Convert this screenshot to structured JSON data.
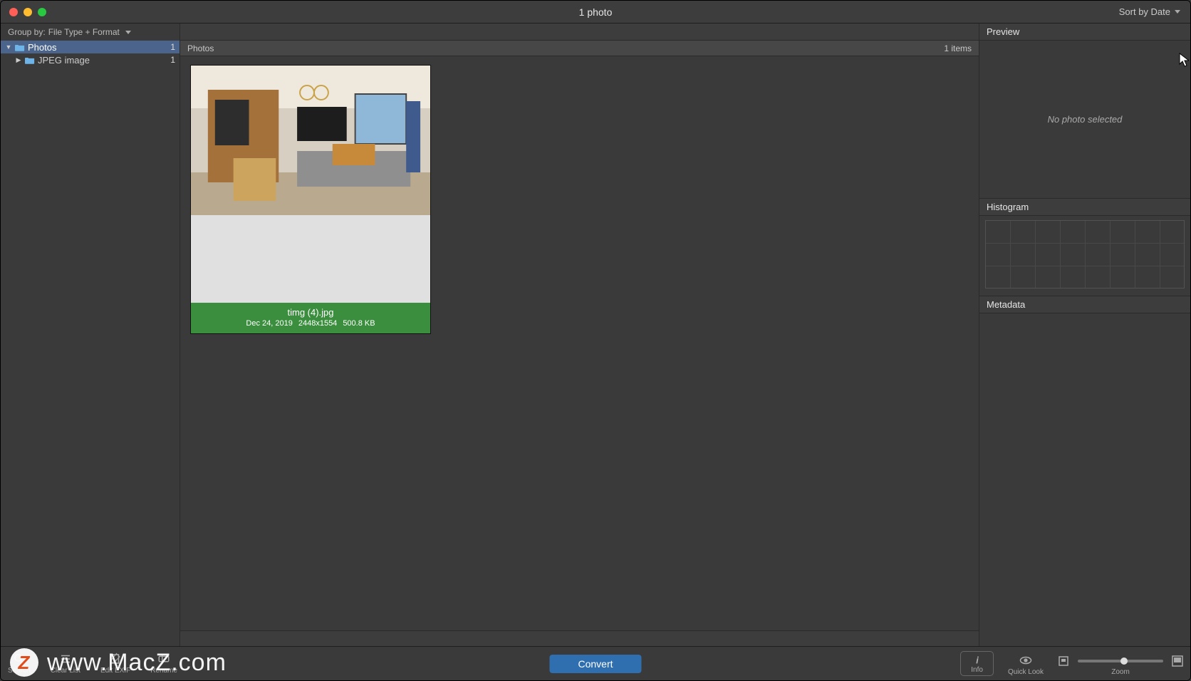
{
  "titlebar": {
    "title": "1 photo",
    "sort_label": "Sort by Date"
  },
  "sidebar": {
    "groupby_label": "Group by:",
    "groupby_value": "File Type + Format",
    "tree": [
      {
        "label": "Photos",
        "count": "1",
        "selected": true,
        "level": 0,
        "expanded": true
      },
      {
        "label": "JPEG image",
        "count": "1",
        "selected": false,
        "level": 1,
        "expanded": false
      }
    ]
  },
  "center": {
    "section_label": "Photos",
    "item_count_label": "1 items",
    "thumbs": [
      {
        "filename": "timg (4).jpg",
        "date": "Dec 24, 2019",
        "dimensions": "2448x1554",
        "filesize": "500.8 KB"
      }
    ]
  },
  "inspector": {
    "preview_label": "Preview",
    "preview_empty_text": "No photo selected",
    "histogram_label": "Histogram",
    "metadata_label": "Metadata"
  },
  "toolbar": {
    "search_label": "Search",
    "clearlist_label": "Clear List",
    "editexif_label": "Edit EXIF",
    "rename_label": "Rename",
    "convert_label": "Convert",
    "info_label": "Info",
    "quicklook_label": "Quick Look",
    "zoom_label": "Zoom"
  },
  "watermark": {
    "logo": "Z",
    "text": "www.MacZ.com"
  }
}
